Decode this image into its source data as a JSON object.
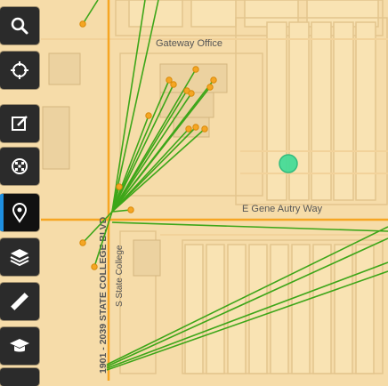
{
  "map": {
    "labels": {
      "gateway_office": "Gateway Office",
      "e_gene_autry_way": "E Gene Autry Way",
      "state_college_blvd": "1901 - 2039 STATE COLLEGE BLVD",
      "s_state_college": "S State College"
    },
    "colors": {
      "background": "#f6dca9",
      "block_fill": "#f9e3b3",
      "block_stroke": "#e3c58d",
      "major_road": "#f6a623",
      "connection_line": "#3da619",
      "point_fill": "#f5a623",
      "point_stroke": "#d98a0a",
      "selected_marker": "#3ddc97"
    }
  },
  "toolbar": {
    "items": [
      {
        "icon": "search-icon",
        "label": "Search"
      },
      {
        "icon": "crosshair-icon",
        "label": "Locate"
      },
      {
        "icon": "edit-icon",
        "label": "Edit"
      },
      {
        "icon": "basemap-grid-icon",
        "label": "Basemap"
      },
      {
        "icon": "view-location-icon",
        "label": "View",
        "active": true
      },
      {
        "icon": "layers-icon",
        "label": "Layers"
      },
      {
        "icon": "ruler-icon",
        "label": "Measure"
      },
      {
        "icon": "education-icon",
        "label": "Tutorial"
      }
    ]
  }
}
